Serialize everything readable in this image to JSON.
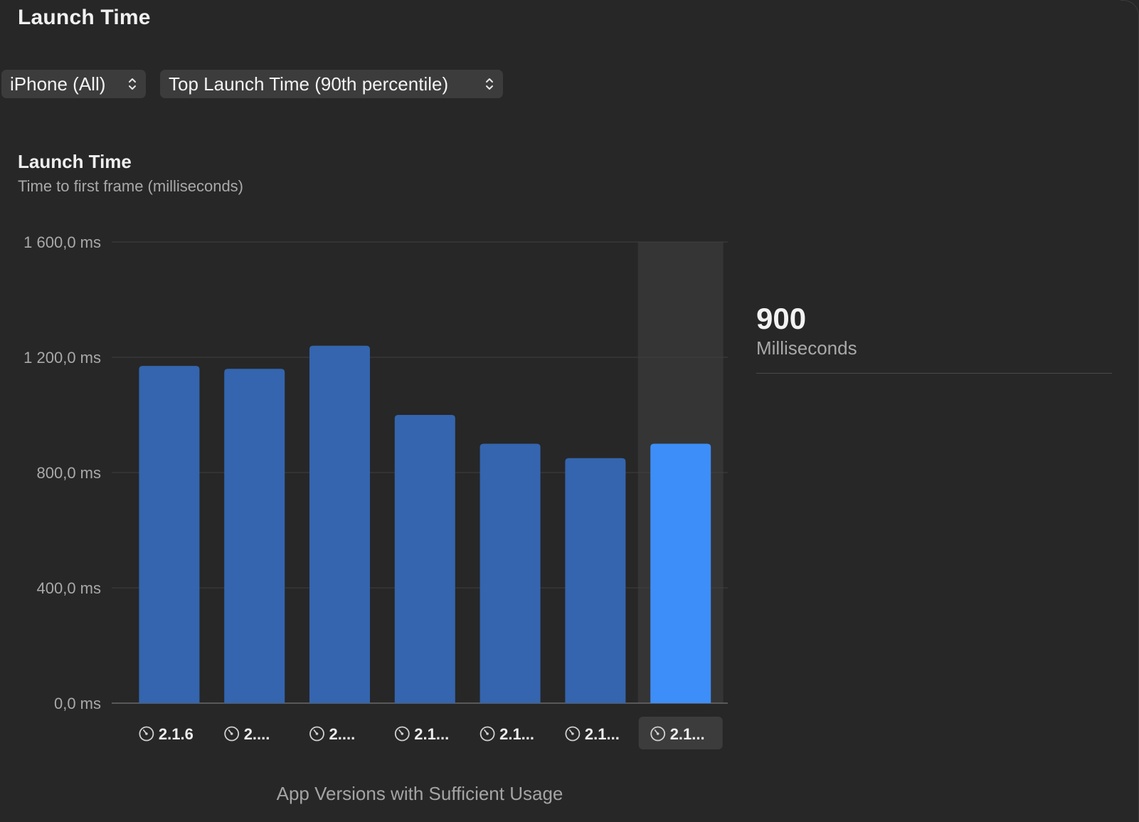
{
  "window": {
    "title": "Launch Time"
  },
  "filters": {
    "device": {
      "selected": "iPhone (All)",
      "icon": "chevron-up-down-icon"
    },
    "metric": {
      "selected": "Top Launch Time (90th percentile)",
      "icon": "chevron-up-down-icon"
    }
  },
  "chart_header": {
    "title": "Launch Time",
    "subtitle": "Time to first frame (milliseconds)"
  },
  "chart_data": {
    "type": "bar",
    "unit": "ms",
    "y_ticks": [
      "1 600,0 ms",
      "1 200,0 ms",
      "800,0 ms",
      "400,0 ms",
      "0,0 ms"
    ],
    "y_tick_values": [
      1600,
      1200,
      800,
      400,
      0
    ],
    "ylim": [
      0,
      1600
    ],
    "grid": true,
    "categories": [
      "2.1.6",
      "2....",
      "2....",
      "2.1...",
      "2.1...",
      "2.1...",
      "2.1..."
    ],
    "values": [
      1170,
      1160,
      1240,
      1000,
      900,
      850,
      900
    ],
    "selected_index": 6,
    "xlabel": "App Versions with Sufficient Usage",
    "category_icon": "gauge-icon",
    "colors": {
      "bar": "#3465ae",
      "bar_selected": "#3d8ef8",
      "selection_band": "#353535",
      "grid": "#3f3f3f",
      "axis": "#6a6a6a"
    }
  },
  "detail": {
    "value": "900",
    "unit": "Milliseconds"
  }
}
